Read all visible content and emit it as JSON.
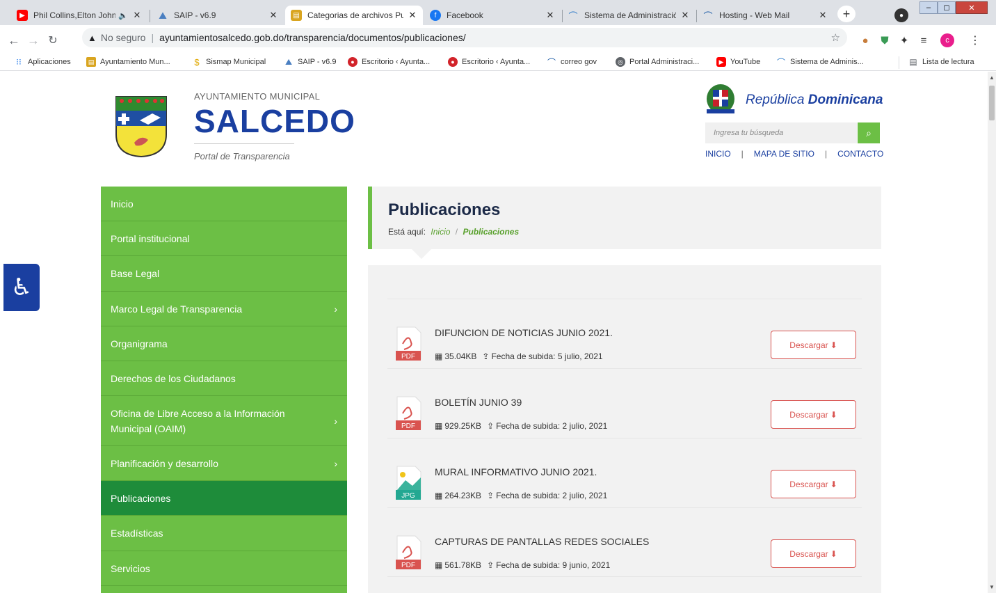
{
  "browser": {
    "tabs": [
      {
        "title": "Phil Collins,Elton John"
      },
      {
        "title": "SAIP - v6.9"
      },
      {
        "title": "Categorias de archivos Pu"
      },
      {
        "title": "Facebook"
      },
      {
        "title": "Sistema de Administració"
      },
      {
        "title": "Hosting - Web Mail"
      }
    ],
    "security_label": "No seguro",
    "url": "ayuntamientosalcedo.gob.do/transparencia/documentos/publicaciones/",
    "profile_initial": "c",
    "bookmarks": [
      {
        "label": "Aplicaciones"
      },
      {
        "label": "Ayuntamiento Mun..."
      },
      {
        "label": "Sismap Municipal"
      },
      {
        "label": "SAIP - v6.9"
      },
      {
        "label": "Escritorio ‹ Ayunta..."
      },
      {
        "label": "Escritorio ‹ Ayunta..."
      },
      {
        "label": "correo gov"
      },
      {
        "label": "Portal Administraci..."
      },
      {
        "label": "YouTube"
      },
      {
        "label": "Sistema de Adminis..."
      }
    ],
    "reading_list": "Lista de lectura"
  },
  "header": {
    "org_small": "AYUNTAMIENTO MUNICIPAL",
    "org_big": "SALCEDO",
    "org_sub": "Portal de Transparencia",
    "rd_text_1": "República",
    "rd_text_2": "Dominicana",
    "search_placeholder": "Ingresa tu búsqueda",
    "top_links": [
      "INICIO",
      "MAPA DE SITIO",
      "CONTACTO"
    ]
  },
  "sidebar": {
    "items": [
      {
        "label": "Inicio"
      },
      {
        "label": "Portal institucional"
      },
      {
        "label": "Base Legal"
      },
      {
        "label": "Marco Legal de Transparencia"
      },
      {
        "label": "Organigrama"
      },
      {
        "label": "Derechos de los Ciudadanos"
      },
      {
        "label": "Oficina de Libre Acceso a la Información Municipal (OAIM)"
      },
      {
        "label": "Planificación y desarrollo"
      },
      {
        "label": "Publicaciones"
      },
      {
        "label": "Estadísticas"
      },
      {
        "label": "Servicios"
      }
    ]
  },
  "main": {
    "title": "Publicaciones",
    "breadcrumb_prefix": "Está aquí:",
    "breadcrumb_home": "Inicio",
    "breadcrumb_sep": "/",
    "breadcrumb_current": "Publicaciones",
    "documents": [
      {
        "title": "DIFUNCION DE NOTICIAS JUNIO 2021.",
        "type": "PDF",
        "size": "35.04KB",
        "date_label": "Fecha de subida:",
        "date": "5 julio, 2021",
        "button": "Descargar"
      },
      {
        "title": "BOLETÍN JUNIO 39",
        "type": "PDF",
        "size": "929.25KB",
        "date_label": "Fecha de subida:",
        "date": "2 julio, 2021",
        "button": "Descargar"
      },
      {
        "title": "MURAL INFORMATIVO JUNIO 2021.",
        "type": "JPG",
        "size": "264.23KB",
        "date_label": "Fecha de subida:",
        "date": "2 julio, 2021",
        "button": "Descargar"
      },
      {
        "title": "CAPTURAS DE PANTALLAS REDES SOCIALES",
        "type": "PDF",
        "size": "561.78KB",
        "date_label": "Fecha de subida:",
        "date": "9 junio, 2021",
        "button": "Descargar"
      }
    ]
  },
  "colors": {
    "sidebar_green": "#6cbf45",
    "sidebar_active": "#1e8c3a",
    "accent_blue": "#1a3fa0",
    "download_red": "#d9534f",
    "breadcrumb_green": "#5aa12e"
  }
}
